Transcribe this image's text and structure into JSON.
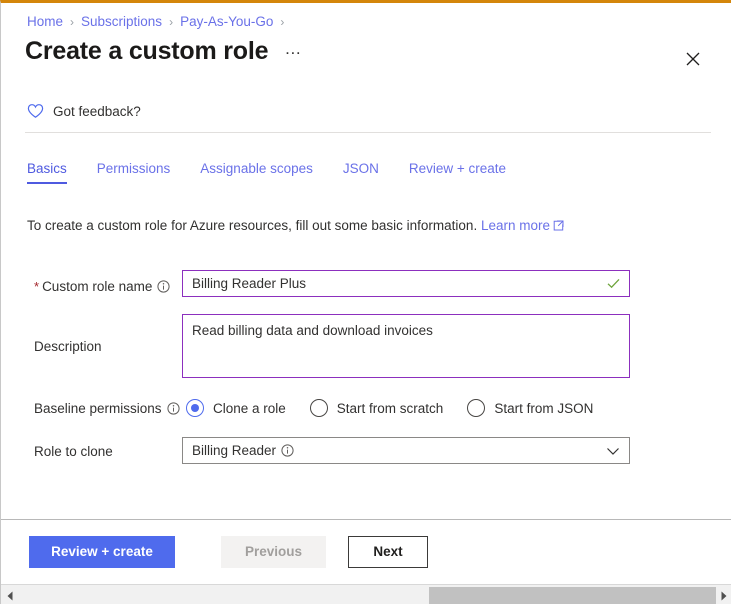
{
  "window": {
    "accent_top_border": "#d4860b",
    "close_icon": "close-icon"
  },
  "breadcrumb": {
    "items": [
      {
        "label": "Home"
      },
      {
        "label": "Subscriptions"
      },
      {
        "label": "Pay-As-You-Go"
      }
    ],
    "separator": "›"
  },
  "header": {
    "title": "Create a custom role",
    "more_menu": "…",
    "close_label": "✕"
  },
  "feedback": {
    "label": "Got feedback?",
    "icon": "heart-icon"
  },
  "tabs": [
    {
      "label": "Basics",
      "active": true
    },
    {
      "label": "Permissions",
      "active": false
    },
    {
      "label": "Assignable scopes",
      "active": false
    },
    {
      "label": "JSON",
      "active": false
    },
    {
      "label": "Review + create",
      "active": false
    }
  ],
  "intro": {
    "text": "To create a custom role for Azure resources, fill out some basic information.",
    "link_label": "Learn more",
    "link_icon": "external-link-icon"
  },
  "form": {
    "custom_role_name": {
      "label": "Custom role name",
      "required": true,
      "required_marker": "*",
      "info_icon": "info-icon",
      "value": "Billing Reader Plus",
      "placeholder": "",
      "validation_icon": "checkmark-icon",
      "border_color": "#8c2fbe"
    },
    "description": {
      "label": "Description",
      "value": "Read billing data and download invoices",
      "placeholder": "",
      "border_color": "#8c2fbe"
    },
    "baseline_permissions": {
      "label": "Baseline permissions",
      "info_icon": "info-icon",
      "options": [
        {
          "label": "Clone a role",
          "selected": true
        },
        {
          "label": "Start from scratch",
          "selected": false
        },
        {
          "label": "Start from JSON",
          "selected": false
        }
      ]
    },
    "role_to_clone": {
      "label": "Role to clone",
      "value": "Billing Reader",
      "info_icon": "info-icon",
      "chevron_icon": "chevron-down-icon"
    }
  },
  "footer": {
    "review_create_label": "Review + create",
    "previous_label": "Previous",
    "previous_disabled": true,
    "next_label": "Next",
    "primary_color": "#4f6bed"
  },
  "scrollbar": {
    "left_arrow": "◀",
    "right_arrow": "▶",
    "orientation": "horizontal"
  }
}
